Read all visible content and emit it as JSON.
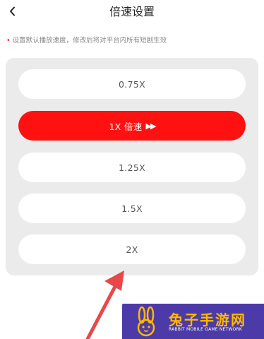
{
  "header": {
    "back_icon": "chevron-left-icon",
    "title": "倍速设置"
  },
  "hint": {
    "dot": "•",
    "text": "设置默认播放速度，修改后将对平台内所有短剧生效"
  },
  "speed_options": [
    {
      "label": "0.75X",
      "selected": false
    },
    {
      "label": "1X 倍速",
      "selected": true,
      "icon": "fast-forward-icon",
      "icon_glyph": "▶▶"
    },
    {
      "label": "1.25X",
      "selected": false
    },
    {
      "label": "1.5X",
      "selected": false
    },
    {
      "label": "2X",
      "selected": false
    }
  ],
  "colors": {
    "accent": "#ff1111",
    "panel": "#ebebeb",
    "arrow": "#e8484a",
    "watermark_bg": "#4c3aa8",
    "watermark_text": "#ffb800"
  },
  "watermark": {
    "title": "兔子手游网",
    "subtitle": "RABBIT MOBILE GAME NETWORK"
  }
}
